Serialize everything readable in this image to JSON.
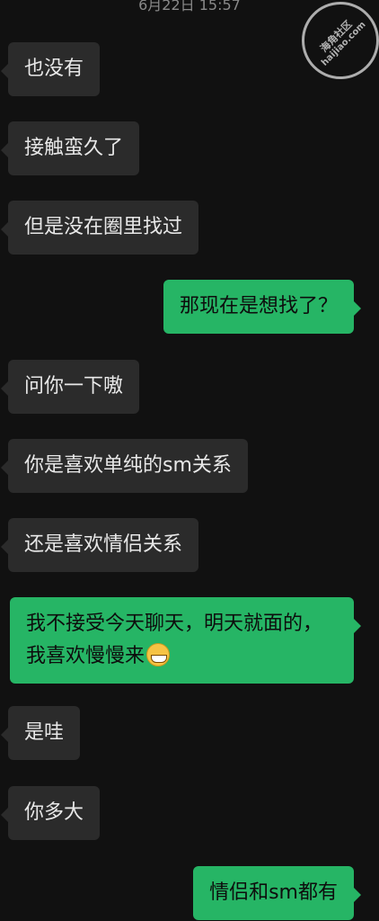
{
  "header": {
    "timestamp": "6月22日 15:57"
  },
  "watermark": {
    "line1": "海角社区",
    "line2": "haijiao.com"
  },
  "messages": [
    {
      "side": "in",
      "text": "也没有"
    },
    {
      "side": "in",
      "text": "接触蛮久了"
    },
    {
      "side": "in",
      "text": "但是没在圈里找过"
    },
    {
      "side": "out",
      "text": "那现在是想找了？"
    },
    {
      "side": "in",
      "text": "问你一下嗷"
    },
    {
      "side": "in",
      "text": "你是喜欢单纯的sm关系"
    },
    {
      "side": "in",
      "text": "还是喜欢情侣关系"
    },
    {
      "side": "out",
      "text": "我不接受今天聊天，明天就面的，我喜欢慢慢来",
      "emoji": "grin-emoji"
    },
    {
      "side": "in",
      "text": "是哇"
    },
    {
      "side": "in",
      "text": "你多大"
    },
    {
      "side": "out",
      "text": "情侣和sm都有"
    }
  ]
}
